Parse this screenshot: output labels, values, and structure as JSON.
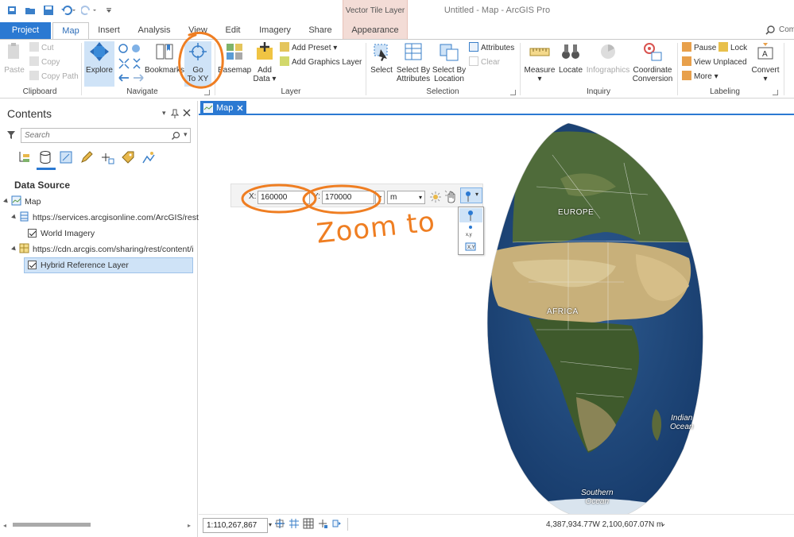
{
  "app": {
    "title": "Untitled - Map - ArcGIS Pro",
    "contextual_header": "Vector Tile Layer",
    "right_cut_text": "Com"
  },
  "tabs": [
    {
      "label": "Project"
    },
    {
      "label": "Map"
    },
    {
      "label": "Insert"
    },
    {
      "label": "Analysis"
    },
    {
      "label": "View"
    },
    {
      "label": "Edit"
    },
    {
      "label": "Imagery"
    },
    {
      "label": "Share"
    },
    {
      "label": "Appearance"
    }
  ],
  "ribbon": {
    "clipboard": {
      "label": "Clipboard",
      "paste": "Paste",
      "cut": "Cut",
      "copy": "Copy",
      "copy_path": "Copy Path"
    },
    "navigate": {
      "label": "Navigate",
      "explore": "Explore",
      "bookmarks": "Bookmarks",
      "go_to_xy_line1": "Go",
      "go_to_xy_line2": "To XY"
    },
    "layer": {
      "label": "Layer",
      "basemap": "Basemap",
      "add_data_line1": "Add",
      "add_data_line2": "Data",
      "add_preset": "Add Preset",
      "add_graphics_layer": "Add Graphics Layer"
    },
    "selection": {
      "label": "Selection",
      "select": "Select",
      "select_by_attributes_line1": "Select By",
      "select_by_attributes_line2": "Attributes",
      "select_by_location_line1": "Select By",
      "select_by_location_line2": "Location",
      "attributes": "Attributes",
      "clear": "Clear"
    },
    "inquiry": {
      "label": "Inquiry",
      "measure": "Measure",
      "locate": "Locate",
      "infographics": "Infographics",
      "coord_line1": "Coordinate",
      "coord_line2": "Conversion"
    },
    "labeling": {
      "label": "Labeling",
      "pause": "Pause",
      "lock": "Lock",
      "view_unplaced": "View Unplaced",
      "more": "More",
      "convert": "Convert"
    }
  },
  "contents": {
    "title": "Contents",
    "search_placeholder": "Search",
    "section_title": "Data Source",
    "tree": [
      {
        "label": "Map"
      },
      {
        "label": "https://services.arcgisonline.com/ArcGIS/rest/"
      },
      {
        "label": "World Imagery"
      },
      {
        "label": "https://cdn.arcgis.com/sharing/rest/content/i"
      },
      {
        "label": "Hybrid Reference Layer"
      }
    ]
  },
  "map_view": {
    "tab_label": "Map",
    "xy": {
      "x_label": "X:",
      "x_value": "160000",
      "y_label": "Y:",
      "y_value": "170000",
      "units": "m"
    },
    "annotation_text": "Zoom to",
    "map_labels": {
      "europe": "EUROPE",
      "africa": "AFRICA",
      "indian_ocean_1": "Indian",
      "indian_ocean_2": "Ocean",
      "southern_ocean_1": "Southern",
      "southern_ocean_2": "Ocean"
    }
  },
  "status_bar": {
    "scale": "1:110,267,867",
    "coordinates": "4,387,934.77W 2,100,607.07N m"
  },
  "colors": {
    "accent": "#2b79d2",
    "annotation": "#ef7e22",
    "contextual_tab": "#f3dcd6"
  }
}
